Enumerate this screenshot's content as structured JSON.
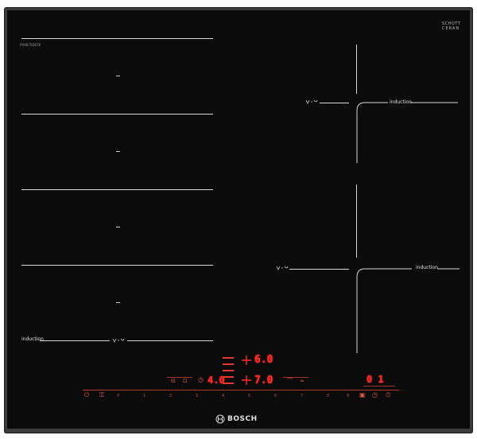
{
  "brand": {
    "glass_maker_line1": "SCHOTT",
    "glass_maker_line2": "CERAN",
    "glass_small": "",
    "model_code": "PXX875D67E",
    "logo_text": "BOSCH"
  },
  "zones": {
    "left_label": "induction",
    "right_top_label": "induction",
    "right_bottom_label": "induction"
  },
  "displays": {
    "timer_top": "6.0",
    "timer_mid": "4.0",
    "timer_mid_right": "7.0",
    "right_display": "0 1"
  },
  "power_scale": [
    "0",
    "1",
    "2",
    "3",
    "4",
    "5",
    "6",
    "7",
    "8",
    "9"
  ],
  "colors": {
    "glass": "#0b0b0b",
    "frame": "#3c3c3c",
    "control_red": "#ff2b2b"
  },
  "icons": [
    "power-icon",
    "child-lock-icon",
    "booster-icon",
    "timer-icon",
    "clock-icon"
  ]
}
